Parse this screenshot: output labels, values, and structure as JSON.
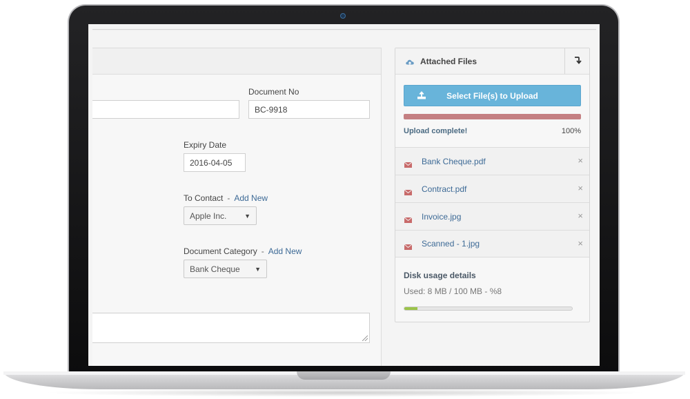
{
  "form": {
    "document_no_label": "Document No",
    "document_no_value": "BC-9918",
    "expiry_date_label": "Expiry Date",
    "expiry_date_value": "2016-04-05",
    "to_contact_label": "To Contact",
    "to_contact_separator": "-",
    "to_contact_add_new": "Add New",
    "to_contact_value": "Apple Inc.",
    "document_category_label": "Document Category",
    "document_category_separator": "-",
    "document_category_add_new": "Add New",
    "document_category_value": "Bank Cheque"
  },
  "attached_files": {
    "title": "Attached Files",
    "upload_button": "Select File(s) to Upload",
    "upload_status": "Upload complete!",
    "upload_percent": "100%",
    "upload_progress": 1.0,
    "files": [
      {
        "name": "Bank Cheque.pdf"
      },
      {
        "name": "Contract.pdf"
      },
      {
        "name": "Invoice.jpg"
      },
      {
        "name": "Scanned - 1.jpg"
      }
    ],
    "remove_symbol": "×",
    "disk_title": "Disk usage details",
    "disk_usage": "Used: 8 MB / 100 MB - %8",
    "disk_progress": 0.08
  },
  "colors": {
    "upload_button": "#68b4da",
    "progress_fill": "#c47f82",
    "disk_fill": "#9bc34a",
    "link": "#3d6a96",
    "file_icon": "#c86a6a"
  },
  "icons": {
    "header_icon": "cloud-icon",
    "toggle_icon": "arrow-turn-down-icon",
    "upload_icon": "upload-icon",
    "file_icon": "envelope-icon",
    "remove_icon": "close-icon"
  }
}
